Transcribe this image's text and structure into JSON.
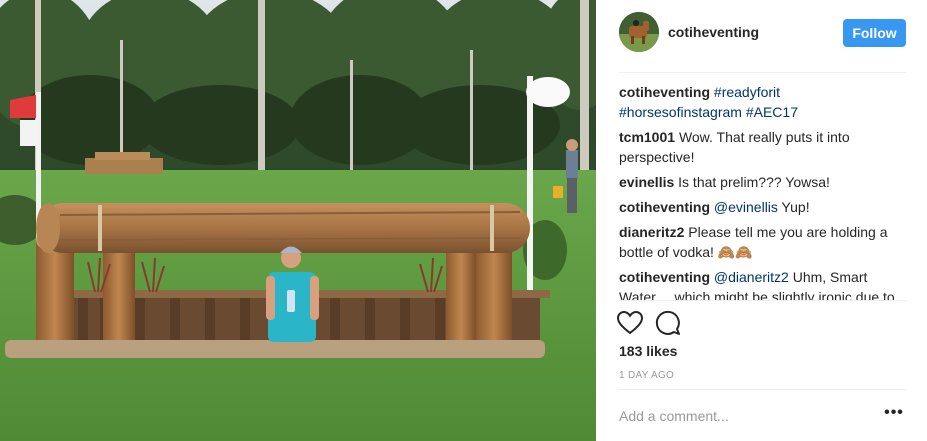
{
  "post": {
    "username": "cotiheventing",
    "follow_label": "Follow",
    "caption": {
      "user": "cotiheventing",
      "tags": [
        "#readyforit",
        "#horsesofinstagram",
        "#AEC17"
      ]
    },
    "comments": [
      {
        "user": "tcm1001",
        "text": "Wow. That really puts it into perspective!"
      },
      {
        "user": "evinellis",
        "text": "Is that prelim??? Yowsa!"
      },
      {
        "user": "cotiheventing",
        "mention": "@evinellis",
        "text": " Yup!"
      },
      {
        "user": "dianeritz2",
        "text": "Please tell me you are holding a bottle of vodka! 🙈🙈"
      },
      {
        "user": "cotiheventing",
        "mention": "@dianeritz2",
        "text": " Uhm, Smart Water.... which might be slightly ironic due to what is going to be used"
      }
    ],
    "likes": "183 likes",
    "timestamp": "1 DAY AGO",
    "comment_placeholder": "Add a comment...",
    "more_label": "•••"
  },
  "icons": {
    "like": "heart-outline-icon",
    "comment": "speech-bubble-icon",
    "more": "ellipsis-icon"
  },
  "colors": {
    "follow_button": "#3897f0",
    "hashtag": "#003569",
    "muted": "#999999"
  }
}
